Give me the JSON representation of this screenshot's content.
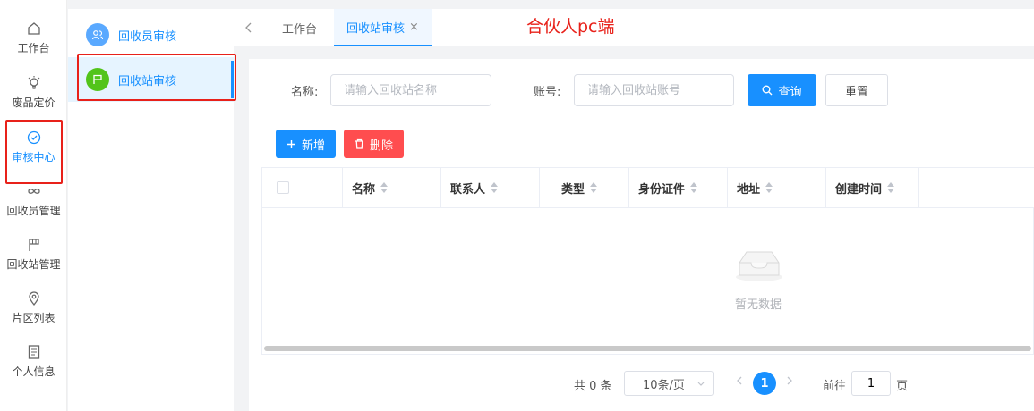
{
  "rail": {
    "items": [
      {
        "label": "工作台",
        "icon": "home-icon"
      },
      {
        "label": "废品定价",
        "icon": "lightbulb-icon"
      },
      {
        "label": "审核中心",
        "icon": "check-circle-icon",
        "active": true
      },
      {
        "label": "回收员管理",
        "icon": "infinity-icon"
      },
      {
        "label": "回收站管理",
        "icon": "flag-icon"
      },
      {
        "label": "片区列表",
        "icon": "location-pin-icon"
      },
      {
        "label": "个人信息",
        "icon": "document-icon"
      }
    ]
  },
  "submenu": {
    "items": [
      {
        "label": "回收员审核",
        "icon": "people-icon",
        "color": "#5aa9ff"
      },
      {
        "label": "回收站审核",
        "icon": "flag-icon",
        "color": "#52c41a",
        "active": true
      }
    ]
  },
  "tabs": {
    "back_icon": "chevron-left-icon",
    "items": [
      {
        "label": "工作台"
      },
      {
        "label": "回收站审核",
        "active": true,
        "closable": true
      }
    ],
    "close_glyph": "×"
  },
  "annotation": "合伙人pc端",
  "search": {
    "name_label": "名称:",
    "name_placeholder": "请输入回收站名称",
    "account_label": "账号:",
    "account_placeholder": "请输入回收站账号",
    "query_label": "查询",
    "reset_label": "重置"
  },
  "toolbar": {
    "add_label": "新增",
    "delete_label": "删除"
  },
  "table": {
    "columns": [
      "名称",
      "联系人",
      "类型",
      "身份证件",
      "地址",
      "创建时间"
    ],
    "empty_text": "暂无数据"
  },
  "pagination": {
    "total_text": "共 0 条",
    "page_size": "10条/页",
    "current_page": "1",
    "goto_label": "前往",
    "goto_value": "1",
    "page_suffix": "页"
  },
  "colors": {
    "accent": "#1890ff",
    "danger": "#ff4d4f",
    "annotation": "#e8211a"
  }
}
